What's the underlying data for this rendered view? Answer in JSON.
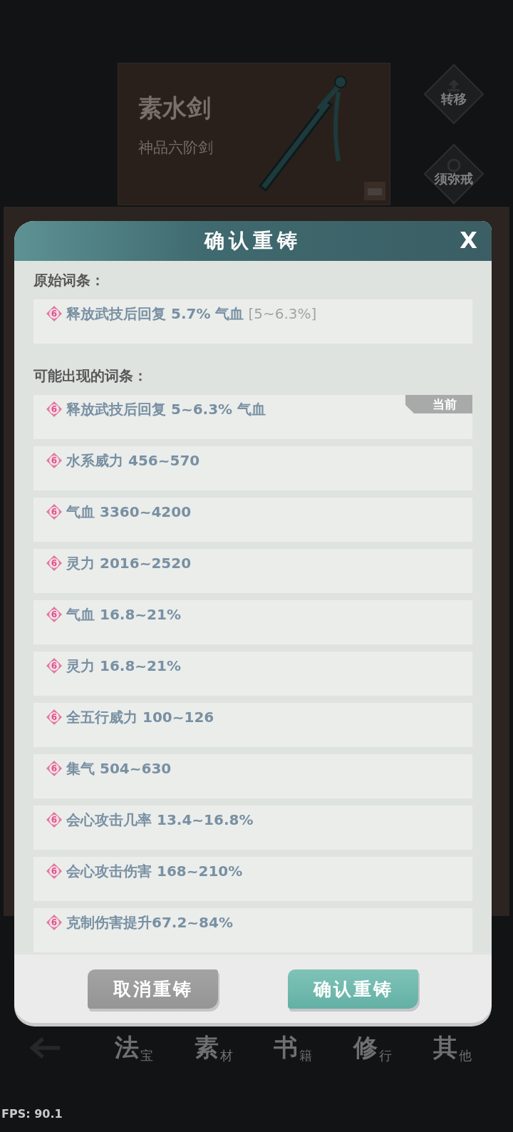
{
  "background": {
    "item_card": {
      "name": "素水剑",
      "grade": "神品六阶剑"
    },
    "side_buttons": [
      {
        "label": "转移",
        "kind": "transfer"
      },
      {
        "label": "须弥戒",
        "kind": "ring"
      }
    ],
    "nav": [
      {
        "main": "法",
        "sub": "宝"
      },
      {
        "main": "素",
        "sub": "材"
      },
      {
        "main": "书",
        "sub": "籍"
      },
      {
        "main": "修",
        "sub": "行"
      },
      {
        "main": "其",
        "sub": "他"
      }
    ]
  },
  "dialog": {
    "title": "确认重铸",
    "close": "X",
    "original_label": "原始词条：",
    "original": {
      "badge": "6",
      "text": "释放武技后回复 5.7% 气血",
      "range": "[5~6.3%]"
    },
    "possible_label": "可能出现的词条：",
    "possible": [
      {
        "badge": "6",
        "text": "释放武技后回复 5~6.3% 气血",
        "tag": "当前"
      },
      {
        "badge": "6",
        "text": "水系威力 456~570"
      },
      {
        "badge": "6",
        "text": "气血 3360~4200"
      },
      {
        "badge": "6",
        "text": "灵力 2016~2520"
      },
      {
        "badge": "6",
        "text": "气血 16.8~21%"
      },
      {
        "badge": "6",
        "text": "灵力 16.8~21%"
      },
      {
        "badge": "6",
        "text": "全五行威力 100~126"
      },
      {
        "badge": "6",
        "text": "集气 504~630"
      },
      {
        "badge": "6",
        "text": "会心攻击几率 13.4~16.8%"
      },
      {
        "badge": "6",
        "text": "会心攻击伤害 168~210%"
      },
      {
        "badge": "6",
        "text": "克制伤害提升67.2~84%"
      }
    ],
    "buttons": [
      {
        "label": "取消重铸",
        "kind": "cancel"
      },
      {
        "label": "确认重铸",
        "kind": "confirm"
      }
    ]
  },
  "fps": "FPS: 90.1"
}
